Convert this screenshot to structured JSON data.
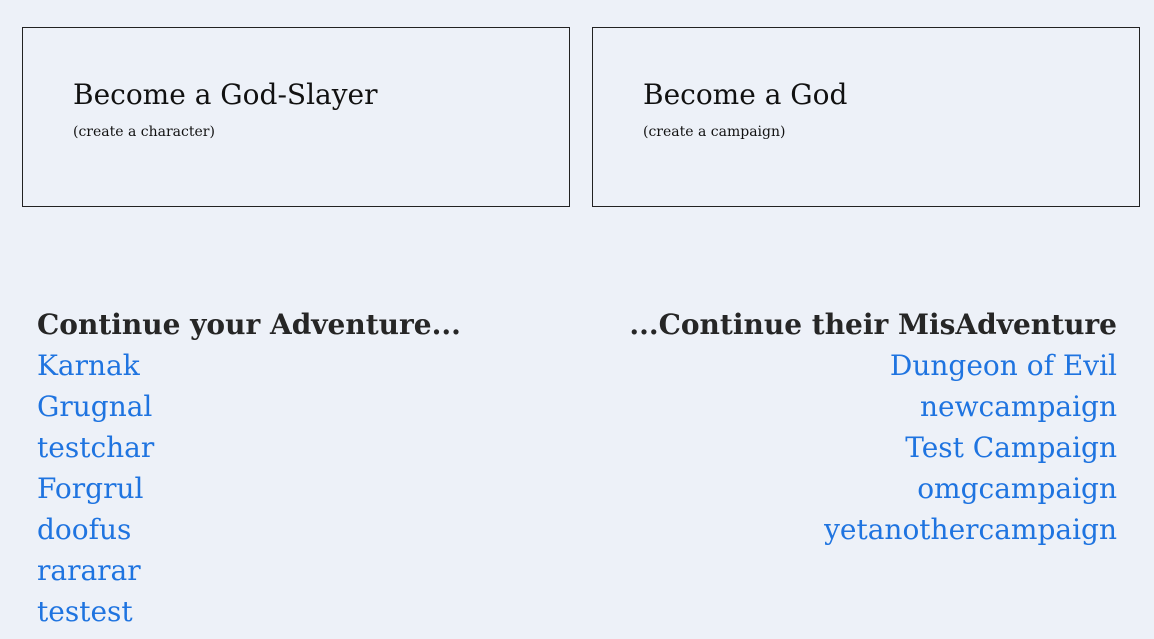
{
  "cards": {
    "character": {
      "title": "Become a God-Slayer",
      "subtitle": "(create a character)"
    },
    "campaign": {
      "title": "Become a God",
      "subtitle": "(create a campaign)"
    }
  },
  "characters": {
    "heading": "Continue your Adventure...",
    "items": [
      "Karnak",
      "Grugnal",
      "testchar",
      "Forgrul",
      "doofus",
      "rararar",
      "testest"
    ]
  },
  "campaigns": {
    "heading": "...Continue their MisAdventure",
    "items": [
      "Dungeon of Evil",
      "newcampaign",
      "Test Campaign",
      "omgcampaign",
      "yetanothercampaign"
    ]
  },
  "colors": {
    "background": "#edf1f8",
    "link": "#1f74e0",
    "text": "#1c1c1c"
  }
}
